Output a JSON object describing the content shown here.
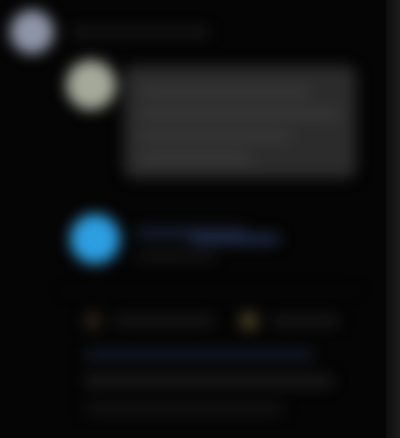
{
  "icons": {
    "top_avatar": "avatar-icon",
    "post_avatar": "avatar-icon",
    "account_avatar": "avatar-icon",
    "reply_action": "reply-icon",
    "favorite_action": "star-icon"
  },
  "colors": {
    "background": "#050505",
    "card": "#2b2b2b",
    "accent_blue": "#2d9ee0",
    "link": "#1f2c4a",
    "highlight_yellow": "#4a4222"
  }
}
